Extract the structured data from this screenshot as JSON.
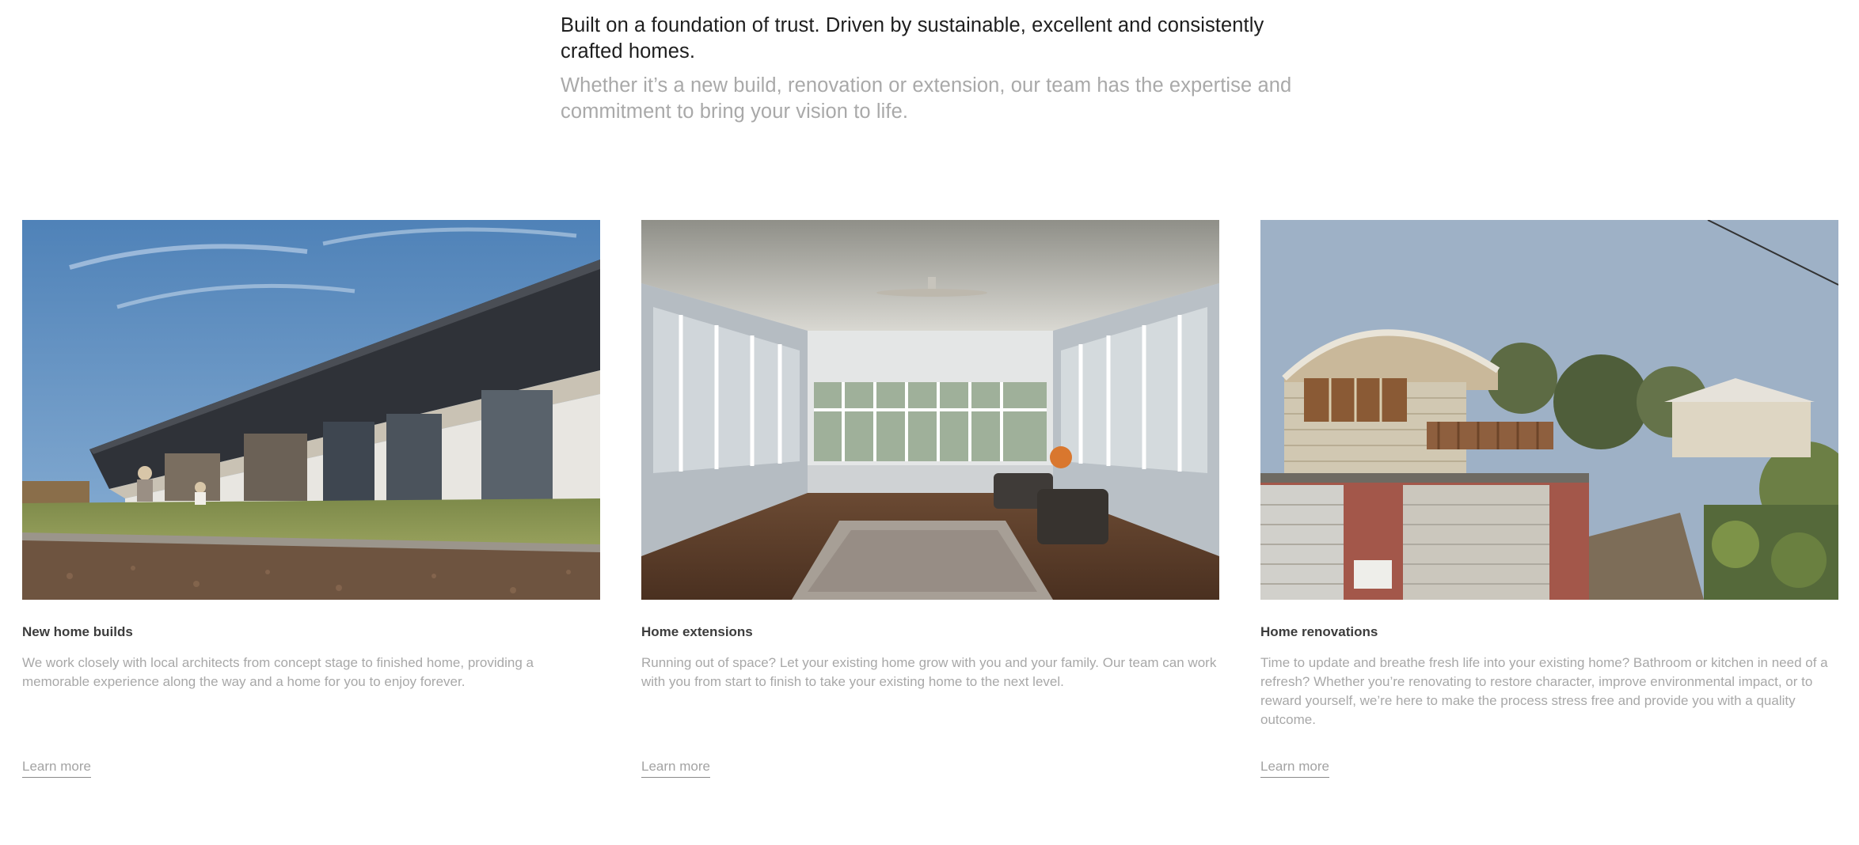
{
  "intro": {
    "lead": "Built on a foundation of trust. Driven by sustainable, excellent and consistently crafted homes.",
    "sub": "Whether it’s a new build, renovation or extension, our team has the expertise and commitment to bring your vision to life."
  },
  "cards": [
    {
      "title": "New home builds",
      "description": "We work closely with local architects from concept stage to finished home, providing a memorable experience along the way and a home for you to enjoy forever.",
      "link": "Learn more",
      "image": "modern-dark-clad-home-exterior-photo"
    },
    {
      "title": "Home extensions",
      "description": "Running out of space? Let your existing home grow with you and your family. Our team can work with you from start to finish to take your existing home to the next level.",
      "link": "Learn more",
      "image": "sunroom-interior-photo"
    },
    {
      "title": "Home renovations",
      "description": "Time to update and breathe fresh life into your existing home? Bathroom or kitchen in need of a refresh? Whether you’re renovating to restore character, improve environmental impact, or to reward yourself, we’re here to make the process stress free and provide you with a quality outcome.",
      "link": "Learn more",
      "image": "curved-roof-renovated-house-photo"
    }
  ]
}
